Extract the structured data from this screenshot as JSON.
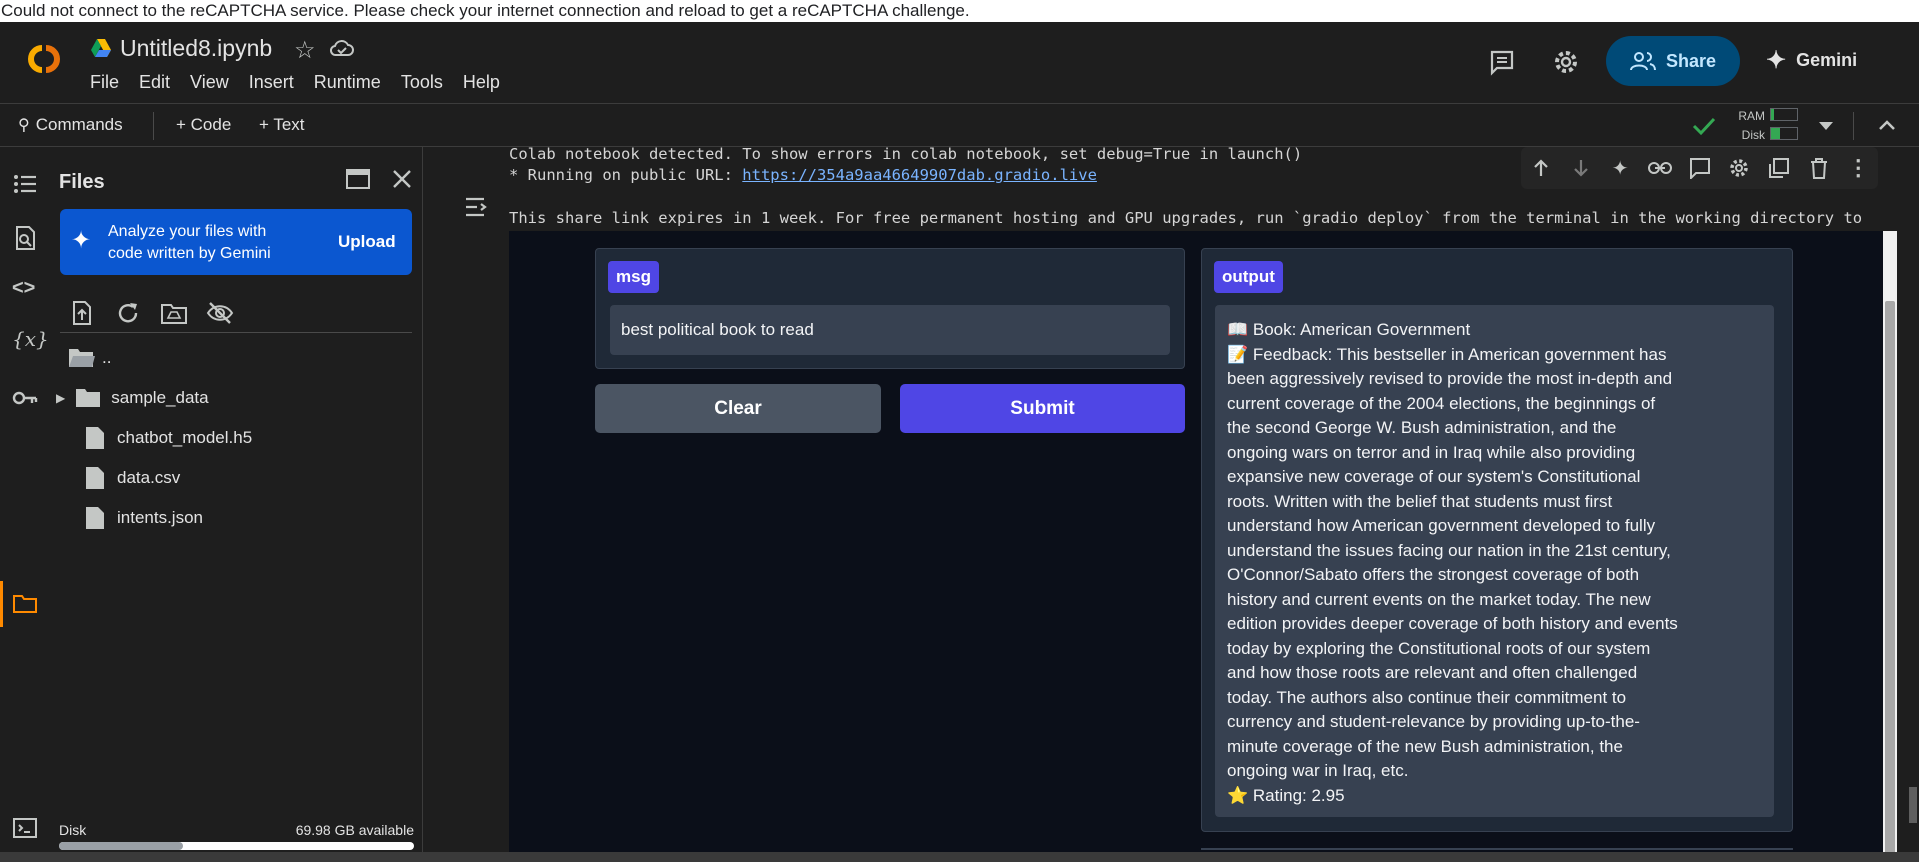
{
  "captcha_message": "Could not connect to the reCAPTCHA service. Please check your internet connection and reload to get a reCAPTCHA challenge.",
  "header": {
    "doc_title": "Untitled8.ipynb",
    "menu": [
      "File",
      "Edit",
      "View",
      "Insert",
      "Runtime",
      "Tools",
      "Help"
    ],
    "share_label": "Share",
    "gemini_label": "Gemini"
  },
  "toolbar": {
    "commands_label": "Commands",
    "code_label": "+ Code",
    "text_label": "+ Text",
    "ram_label": "RAM",
    "disk_label": "Disk"
  },
  "files_panel": {
    "title": "Files",
    "banner_text_1": "Analyze your files with",
    "banner_text_2": "code written by Gemini",
    "upload_label": "Upload",
    "items": [
      {
        "name": "..",
        "type": "folder-parent"
      },
      {
        "name": "sample_data",
        "type": "folder"
      },
      {
        "name": "chatbot_model.h5",
        "type": "file"
      },
      {
        "name": "data.csv",
        "type": "file"
      },
      {
        "name": "intents.json",
        "type": "file"
      }
    ],
    "disk_label": "Disk",
    "disk_available": "69.98 GB available",
    "disk_used_fraction": 0.35
  },
  "output": {
    "line1": "Colab notebook detected. To show errors in colab notebook, set debug=True in launch()",
    "line2_prefix": "* Running on public URL: ",
    "line2_url": "https://354a9aa46649907dab.gradio.live",
    "line3": "This share link expires in 1 week. For free permanent hosting and GPU upgrades, run `gradio deploy` from the terminal in the working directory to"
  },
  "gradio": {
    "msg_label": "msg",
    "msg_value": "best political book to read",
    "clear_label": "Clear",
    "submit_label": "Submit",
    "output_label": "output",
    "output_book": "📖 Book: American Government",
    "output_feedback_lines": [
      "📝 Feedback: This bestseller in American government has",
      "been aggressively revised to provide the most in-depth and",
      "current coverage of the 2004 elections, the beginnings of",
      "the second George W. Bush administration, and the",
      "ongoing wars on terror and in Iraq while also providing",
      "expansive new coverage of our system's Constitutional",
      "roots. Written with the belief that students must first",
      "understand how American government developed to fully",
      "understand the issues facing our nation in the 21st century,",
      "O'Connor/Sabato offers the strongest coverage of both",
      "history and current events on the market today. The new",
      "edition provides deeper coverage of both history and events",
      "today by exploring the Constitutional roots of our system",
      "and how those roots are relevant and often challenged",
      "today. The authors also continue their commitment to",
      "currency and student-relevance by providing up-to-the-",
      "minute coverage of the new Bush administration, the",
      "ongoing war in Iraq, etc."
    ],
    "output_rating": "⭐ Rating: 2.95"
  },
  "colors": {
    "accent_orange": "#ff8a00",
    "share_bg": "#004a77",
    "gemini_banner": "#0b57d0",
    "gradio_primary": "#4f46e5",
    "gradio_bg": "#0b0f19"
  }
}
